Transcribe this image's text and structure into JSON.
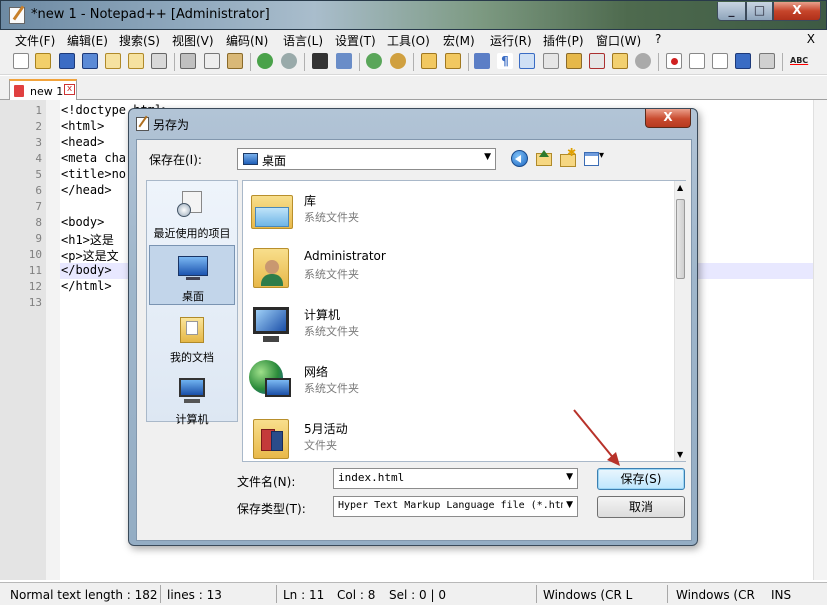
{
  "window": {
    "title": "*new 1 - Notepad++ [Administrator]",
    "min": "_",
    "max": "□",
    "close": "X"
  },
  "menu": {
    "items": [
      "文件(F)",
      "编辑(E)",
      "搜索(S)",
      "视图(V)",
      "编码(N)",
      "语言(L)",
      "设置(T)",
      "工具(O)",
      "宏(M)",
      "运行(R)",
      "插件(P)",
      "窗口(W)",
      "?"
    ],
    "close": "X"
  },
  "tab": {
    "label": "new 1",
    "close": "x"
  },
  "editor": {
    "line_numbers": [
      "1",
      "2",
      "3",
      "4",
      "5",
      "6",
      "7",
      "8",
      "9",
      "10",
      "11",
      "12",
      "13"
    ],
    "lines": [
      "<!doctype html>",
      "<html>",
      "<head>",
      "<meta cha",
      "<title>no",
      "</head>",
      "",
      "<body>",
      "<h1>这是",
      "<p>这是文",
      "</body>",
      "</html>",
      ""
    ]
  },
  "status": {
    "length": "Normal text length : 182",
    "lines": "lines : 13",
    "ln": "Ln : 11",
    "col": "Col : 8",
    "sel": "Sel : 0 | 0",
    "eol": "Windows (CR L",
    "eol2": "Windows (CR",
    "mode": "INS"
  },
  "dialog": {
    "title": "另存为",
    "close": "X",
    "save_in_label": "保存在(I):",
    "save_in_value": "桌面",
    "places": [
      {
        "label": "最近使用的项目",
        "icon": "recent-items-icon"
      },
      {
        "label": "桌面",
        "icon": "desktop-icon"
      },
      {
        "label": "我的文档",
        "icon": "documents-folder-icon"
      },
      {
        "label": "计算机",
        "icon": "computer-icon"
      }
    ],
    "files": [
      {
        "name": "库",
        "type": "系统文件夹",
        "icon": "library-icon"
      },
      {
        "name": "Administrator",
        "type": "系统文件夹",
        "icon": "user-folder-icon"
      },
      {
        "name": "计算机",
        "type": "系统文件夹",
        "icon": "computer-icon"
      },
      {
        "name": "网络",
        "type": "系统文件夹",
        "icon": "network-icon"
      },
      {
        "name": "5月活动",
        "type": "文件夹",
        "icon": "folder-icon"
      }
    ],
    "filename_label": "文件名(N):",
    "filename_value": "index.html",
    "filetype_label": "保存类型(T):",
    "filetype_value": "Hyper Text Markup Language file (*.htm",
    "save_button": "保存(S)",
    "cancel_button": "取消"
  },
  "colors": {
    "accent": "#3c7fb1",
    "tab_accent": "#f2a33b",
    "annotation_arrow": "#b8322a"
  }
}
